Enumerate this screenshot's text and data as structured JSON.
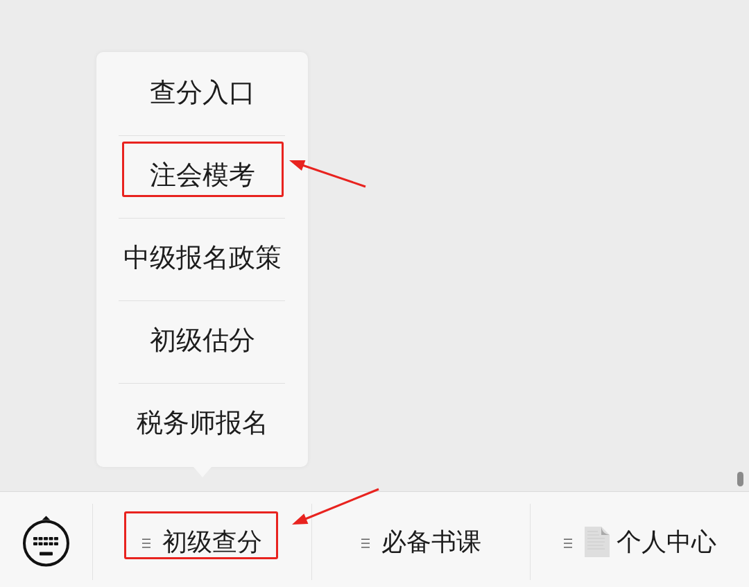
{
  "bottom_menu": {
    "items": [
      {
        "label": "初级查分",
        "has_submenu": true,
        "page_icon": false,
        "annotated": true,
        "submenu_open": true,
        "submenu": [
          {
            "label": "查分入口",
            "annotated": false
          },
          {
            "label": "注会模考",
            "annotated": true
          },
          {
            "label": "中级报名政策",
            "annotated": false
          },
          {
            "label": "初级估分",
            "annotated": false
          },
          {
            "label": "税务师报名",
            "annotated": false
          }
        ]
      },
      {
        "label": "必备书课",
        "has_submenu": true,
        "page_icon": false,
        "annotated": false,
        "submenu_open": false
      },
      {
        "label": "个人中心",
        "has_submenu": true,
        "page_icon": true,
        "annotated": false,
        "submenu_open": false
      }
    ]
  }
}
